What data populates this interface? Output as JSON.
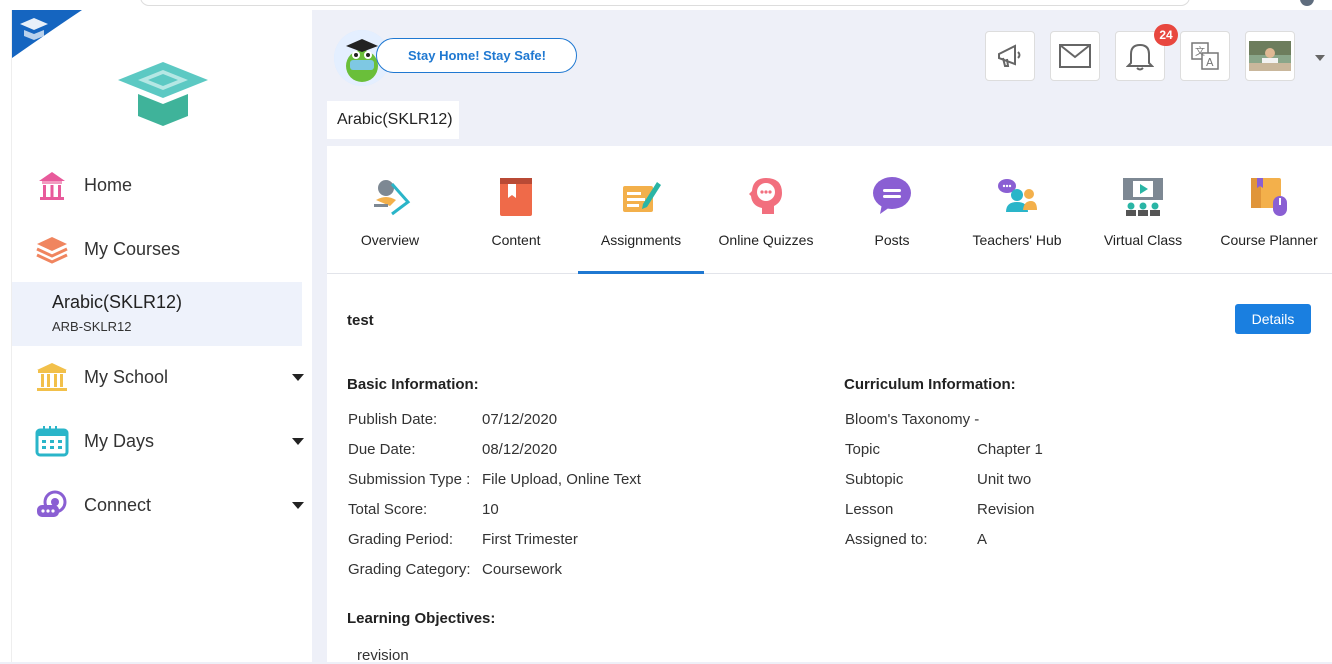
{
  "header": {
    "slogan": "Stay Home! Stay Safe!",
    "notification_count": "24"
  },
  "sidebar": {
    "items": [
      {
        "label": "Home",
        "icon": "home-icon"
      },
      {
        "label": "My Courses",
        "icon": "courses-icon"
      },
      {
        "label": "My School",
        "icon": "school-icon"
      },
      {
        "label": "My Days",
        "icon": "calendar-icon"
      },
      {
        "label": "Connect",
        "icon": "connect-icon"
      }
    ],
    "active_course": {
      "name": "Arabic(SKLR12)",
      "code": "ARB-SKLR12"
    }
  },
  "breadcrumb": "Arabic(SKLR12)",
  "tabs": [
    {
      "label": "Overview",
      "icon": "overview-icon"
    },
    {
      "label": "Content",
      "icon": "content-icon"
    },
    {
      "label": "Assignments",
      "icon": "assignments-icon",
      "active": true
    },
    {
      "label": "Online Quizzes",
      "icon": "quizzes-icon"
    },
    {
      "label": "Posts",
      "icon": "posts-icon"
    },
    {
      "label": "Teachers' Hub",
      "icon": "teachers-hub-icon"
    },
    {
      "label": "Virtual Class",
      "icon": "virtual-class-icon"
    },
    {
      "label": "Course Planner",
      "icon": "course-planner-icon"
    }
  ],
  "assignment": {
    "title": "test",
    "details_label": "Details",
    "basic_heading": "Basic Information:",
    "basic": [
      {
        "key": "Publish Date:",
        "value": "07/12/2020"
      },
      {
        "key": "Due Date:",
        "value": "08/12/2020"
      },
      {
        "key": "Submission Type :",
        "value": "File Upload, Online Text"
      },
      {
        "key": "Total Score:",
        "value": "10"
      },
      {
        "key": "Grading Period:",
        "value": "First Trimester"
      },
      {
        "key": "Grading Category:",
        "value": "Coursework"
      }
    ],
    "curriculum_heading": "Curriculum Information:",
    "curriculum": [
      {
        "key": "Bloom's Taxonomy -",
        "value": ""
      },
      {
        "key": "Topic",
        "value": "Chapter 1"
      },
      {
        "key": "Subtopic",
        "value": "Unit two"
      },
      {
        "key": "Lesson",
        "value": "Revision"
      },
      {
        "key": "Assigned to:",
        "value": "A"
      }
    ],
    "objectives_heading": "Learning Objectives:",
    "objectives": "revision"
  },
  "colors": {
    "accent": "#1f78d1",
    "badge": "#e8473f",
    "active_bg": "#eef2fb"
  }
}
